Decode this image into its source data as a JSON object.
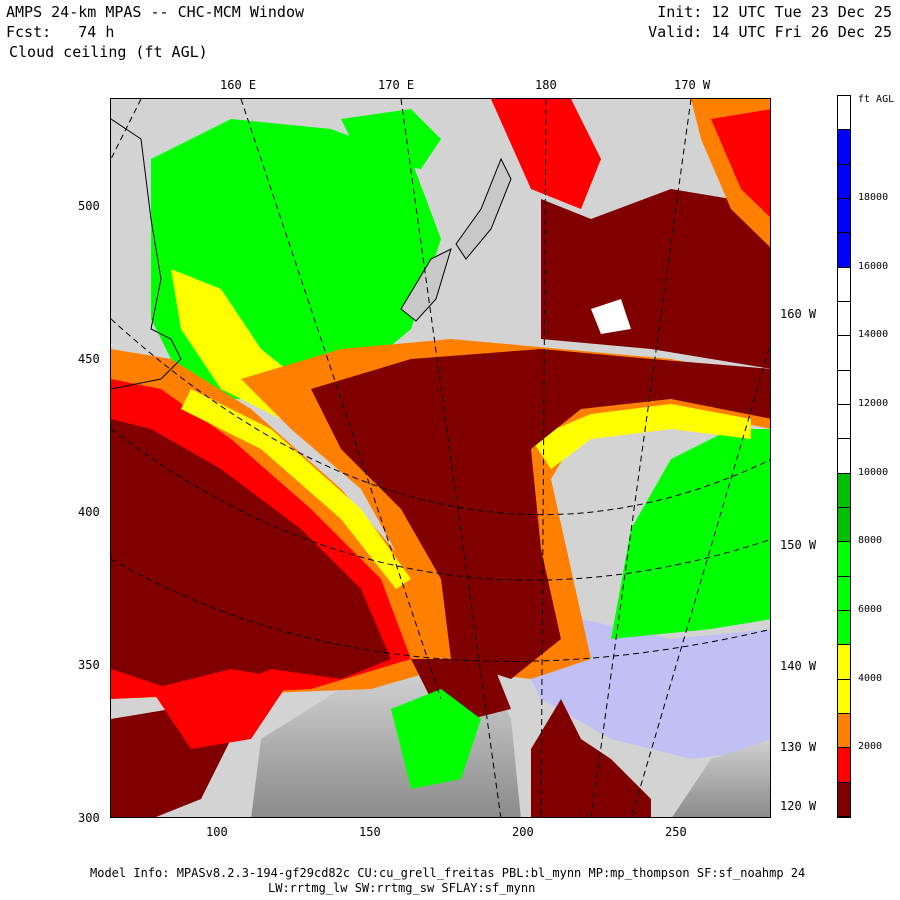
{
  "header": {
    "title": "AMPS 24-km MPAS -- CHC-MCM Window",
    "forecast": "Fcst:   74 h",
    "field": "Cloud ceiling (ft AGL)",
    "init": "Init: 12 UTC Tue 23 Dec 25",
    "valid": "Valid: 14 UTC Fri 26 Dec 25"
  },
  "axes": {
    "top_longitudes": [
      "160 E",
      "170 E",
      "180",
      "170 W"
    ],
    "right_longitudes": [
      "160 W",
      "150 W",
      "140 W",
      "130 W",
      "120 W"
    ],
    "left_ticks": [
      "500",
      "450",
      "400",
      "350",
      "300"
    ],
    "bottom_ticks": [
      "100",
      "150",
      "200",
      "250"
    ]
  },
  "colorbar": {
    "units": "ft AGL",
    "labels": [
      "18000",
      "16000",
      "14000",
      "12000",
      "10000",
      "8000",
      "6000",
      "4000",
      "2000"
    ],
    "segments_top_to_bottom": [
      "#ffffff",
      "#0000ff",
      "#0000ff",
      "#0000ff",
      "#0000ff",
      "#ffffff",
      "#ffffff",
      "#ffffff",
      "#ffffff",
      "#ffffff",
      "#ffffff",
      "#00c000",
      "#00c000",
      "#00ff00",
      "#00ff00",
      "#00ff00",
      "#ffff00",
      "#ffff00",
      "#ff8000",
      "#ff0000",
      "#800000"
    ]
  },
  "colors": {
    "land": "#d3d3d3",
    "very_low": "#800000",
    "low": "#ff0000",
    "orange": "#ff8000",
    "yellow": "#ffff00",
    "green": "#00ff00",
    "dark_green": "#00c000",
    "blue": "#0000ff",
    "lavender": "#c0c0f4"
  },
  "footer": {
    "line1": "Model Info: MPASv8.2.3-194-gf29cd82c CU:cu_grell_freitas PBL:bl_mynn MP:mp_thompson SF:sf_noahmp 24",
    "line2": "LW:rrtmg_lw SW:rrtmg_sw SFLAY:sf_mynn"
  }
}
